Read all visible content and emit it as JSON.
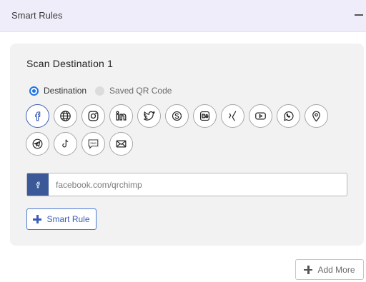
{
  "section": {
    "title": "Smart Rules"
  },
  "card": {
    "title": "Scan Destination 1",
    "radios": [
      {
        "label": "Destination",
        "selected": true
      },
      {
        "label": "Saved QR Code",
        "selected": false
      }
    ],
    "social_icons": [
      "facebook-icon",
      "website-icon",
      "instagram-icon",
      "linkedin-icon",
      "twitter-icon",
      "skype-icon",
      "behance-icon",
      "xing-icon",
      "youtube-icon",
      "whatsapp-icon",
      "location-icon",
      "telegram-icon",
      "tiktok-icon",
      "sms-icon",
      "email-icon"
    ],
    "selected_icon": "facebook-icon",
    "url_field": {
      "placeholder": "facebook.com/qrchimp",
      "value": ""
    },
    "smart_rule_label": "Smart Rule"
  },
  "add_more_label": "Add More",
  "colors": {
    "accent": "#1a73e8",
    "facebook": "#3b5998",
    "header_bg": "#eeedf9",
    "card_bg": "#f2f2f2"
  }
}
